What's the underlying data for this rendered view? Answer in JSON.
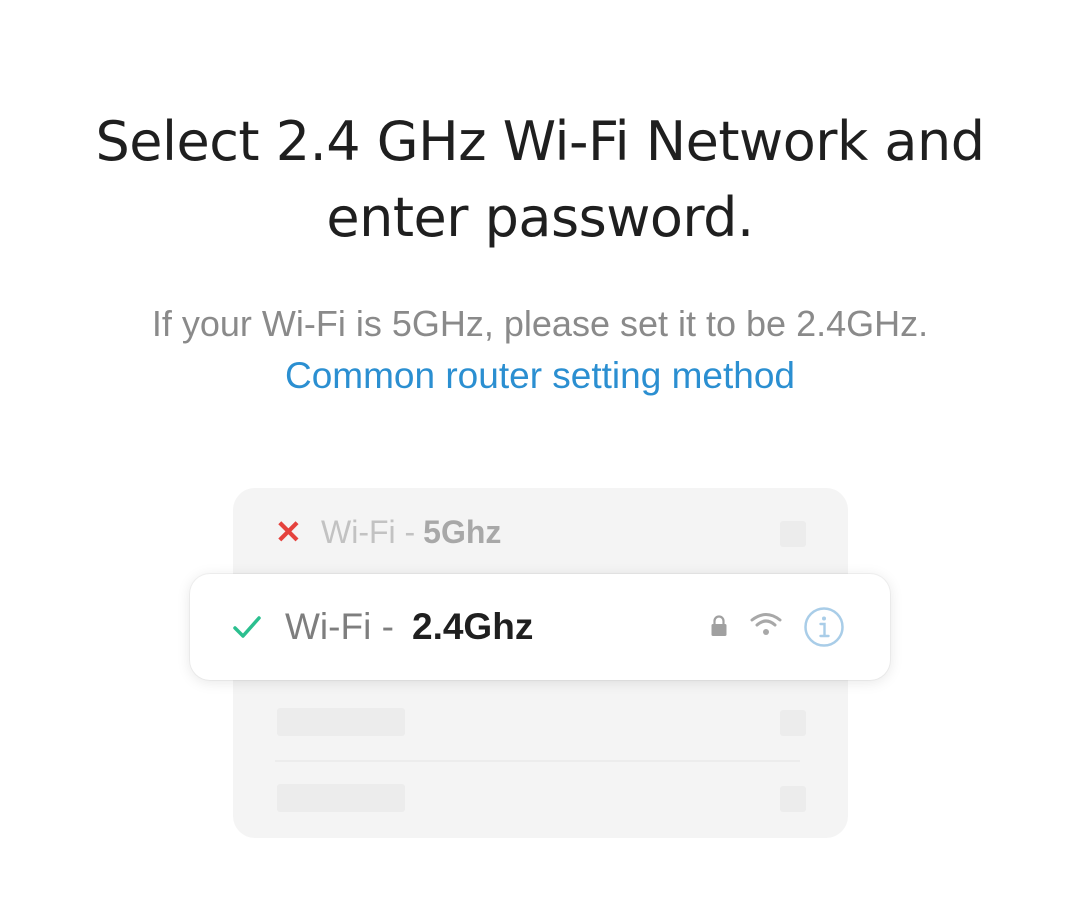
{
  "header": {
    "title_line1": "Select 2.4 GHz Wi-Fi Network and",
    "title_line2": "enter password.",
    "subtitle": "If your Wi-Fi is 5GHz, please set it to be 2.4GHz.",
    "link_text": "Common router setting method"
  },
  "illustration": {
    "wrong_network": {
      "prefix": "Wi-Fi -",
      "band": "5Ghz",
      "status_icon": "x-mark-icon"
    },
    "correct_network": {
      "prefix": "Wi-Fi -",
      "band": "2.4Ghz",
      "status_icon": "check-icon",
      "icons": [
        "lock-icon",
        "wifi-icon",
        "info-icon"
      ]
    }
  },
  "colors": {
    "link": "#2b8fd1",
    "check": "#2bbf8f",
    "x_mark": "#e5423d",
    "info": "#a9cde8"
  }
}
